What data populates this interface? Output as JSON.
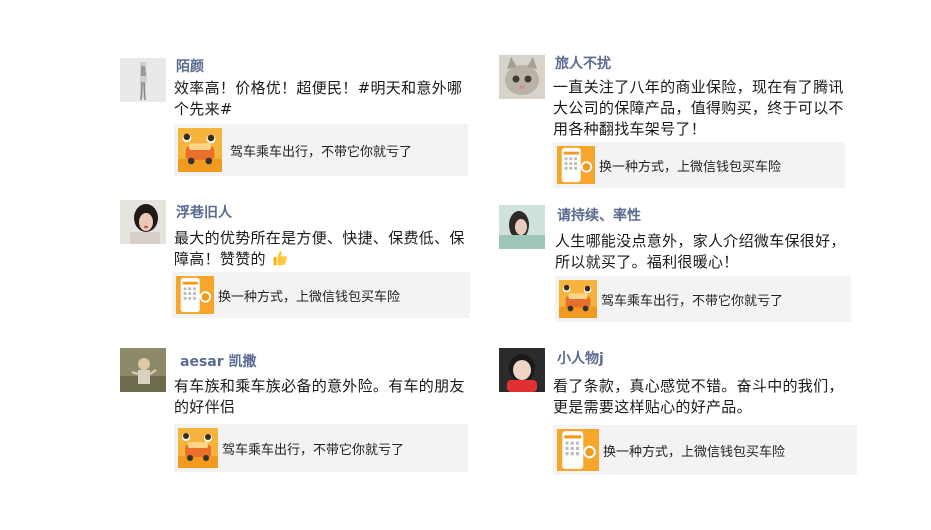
{
  "posts": [
    {
      "author": "陌颜",
      "text": "效率高！价格优！超便民！#明天和意外哪个先来#",
      "card": {
        "title": "驾车乘车出行，不带它你就亏了",
        "type": "car"
      }
    },
    {
      "author": "旅人不扰",
      "text": "一直关注了八年的商业保险，现在有了腾讯大公司的保障产品，值得购买，终于可以不用各种翻找车架号了！",
      "card": {
        "title": "换一种方式，上微信钱包买车险",
        "type": "phone"
      }
    },
    {
      "author": "浮巷旧人",
      "text": "最大的优势所在是方便、快捷、保费低、保障高！赞赞的",
      "card": {
        "title": "换一种方式，上微信钱包买车险",
        "type": "phone"
      }
    },
    {
      "author": "请持续、率性",
      "text": "人生哪能没点意外，家人介绍微车保很好，所以就买了。福利很暖心！",
      "card": {
        "title": "驾车乘车出行，不带它你就亏了",
        "type": "car"
      }
    },
    {
      "author": "aesar 凯撒",
      "text": "有车族和乘车族必备的意外险。有车的朋友的好伴侣",
      "card": {
        "title": "驾车乘车出行，不带它你就亏了",
        "type": "car"
      }
    },
    {
      "author": "小人物j",
      "text": "看了条款，真心感觉不错。奋斗中的我们，更是需要这样贴心的好产品。",
      "card": {
        "title": "换一种方式，上微信钱包买车险",
        "type": "phone"
      }
    }
  ],
  "icons": {
    "thumbs_up": "thumbs-up-emoji",
    "car_thumb": "car-insurance-thumbnail",
    "phone_thumb": "wechat-wallet-phone-thumbnail"
  },
  "colors": {
    "author": "#5b6b92",
    "card_bg": "#f3f3f3",
    "accent_orange": "#f5a623"
  }
}
